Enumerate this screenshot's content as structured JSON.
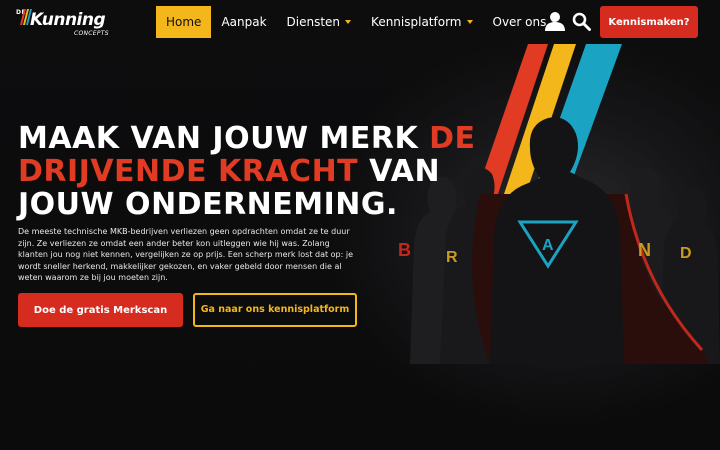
{
  "brand": {
    "prefix": "DE",
    "name": "Kunning",
    "tagline": "CONCEPTS"
  },
  "nav": {
    "items": [
      {
        "label": "Home",
        "active": true,
        "dropdown": false
      },
      {
        "label": "Aanpak",
        "active": false,
        "dropdown": false
      },
      {
        "label": "Diensten",
        "active": false,
        "dropdown": true
      },
      {
        "label": "Kennisplatform",
        "active": false,
        "dropdown": true
      },
      {
        "label": "Over ons",
        "active": false,
        "dropdown": true
      }
    ],
    "cta_label": "Kennismaken?",
    "icons": [
      "user-icon",
      "search-icon"
    ]
  },
  "hero": {
    "headline": {
      "part1": "MAAK VAN JOUW MERK ",
      "highlight": "DE DRIJVENDE KRACHT",
      "part2": " VAN JOUW ONDERNEMING."
    },
    "description": "De meeste technische MKB-bedrijven verliezen geen opdrachten omdat ze te duur zijn. Ze verliezen ze omdat een ander beter kon uitleggen wie hij was. Zolang klanten jou nog niet kennen, vergelijken ze op prijs. Een scherp merk lost dat op: je wordt sneller herkend, makkelijker gekozen, en vaker gebeld door mensen die al weten waarom ze bij jou moeten zijn.",
    "primary_button": "Doe de gratis Merkscan",
    "secondary_button": "Ga naar ons kennisplatform",
    "art_letters": [
      "B",
      "R",
      "A",
      "N",
      "D"
    ]
  },
  "colors": {
    "accent_yellow": "#f4b71b",
    "accent_red": "#d62b1f",
    "headline_red": "#e23b24",
    "stripe_blue": "#1aa3c2",
    "background": "#0b0b0c"
  }
}
